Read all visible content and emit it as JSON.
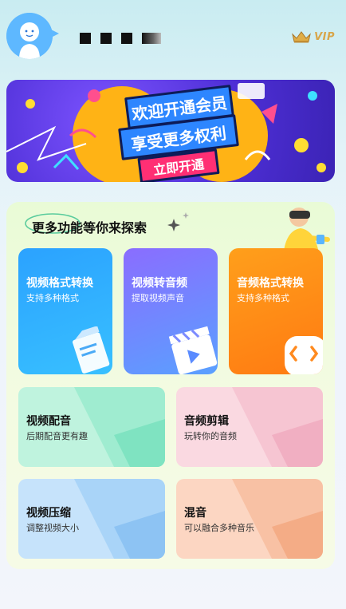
{
  "header": {
    "vip_label": "VIP"
  },
  "banner": {
    "line1": "欢迎开通会员",
    "line2": "享受更多权利",
    "cta": "立即开通",
    "colors": {
      "bg": "#4e2fd6",
      "stripe": "#2d86ff",
      "cta": "#ff2f74"
    }
  },
  "features": {
    "title": "更多功能等你来探索",
    "top_cards": [
      {
        "title": "视频格式转换",
        "subtitle": "支持多种格式",
        "icon": "document-icon"
      },
      {
        "title": "视频转音频",
        "subtitle": "提取视频声音",
        "icon": "clapperboard-icon"
      },
      {
        "title": "音频格式转换",
        "subtitle": "支持多种格式",
        "icon": "audio-waves-icon"
      }
    ],
    "small_cards": [
      {
        "title": "视频配音",
        "subtitle": "后期配音更有趣"
      },
      {
        "title": "音频剪辑",
        "subtitle": "玩转你的音频"
      },
      {
        "title": "视频压缩",
        "subtitle": "调整视频大小"
      },
      {
        "title": "混音",
        "subtitle": "可以融合多种音乐"
      }
    ]
  }
}
